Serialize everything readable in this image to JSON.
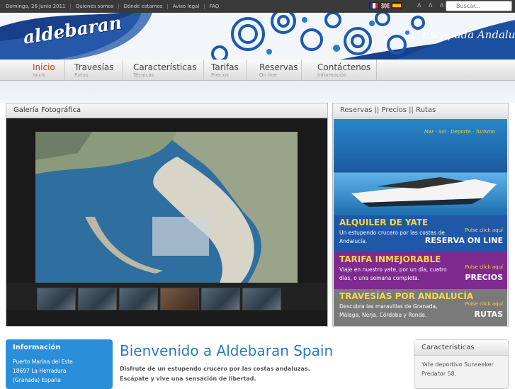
{
  "topbar": {
    "date": "Domingo, 26 Junio 2011",
    "links": [
      "Quienes somos",
      "Dónde estamos",
      "Aviso legal",
      "FAQ"
    ],
    "font_size_controls": "A A A",
    "search_placeholder": "Buscar..."
  },
  "header": {
    "logo": "aldebaran",
    "slogan": "Escapada Andaluza"
  },
  "nav": [
    {
      "label": "Inicio",
      "sub": "Inicio"
    },
    {
      "label": "Travesías",
      "sub": "Rutas"
    },
    {
      "label": "Características",
      "sub": "Técnicas"
    },
    {
      "label": "Tarifas",
      "sub": "Precios"
    },
    {
      "label": "Reservas",
      "sub": "On line"
    },
    {
      "label": "Contáctenos",
      "sub": "Información"
    }
  ],
  "gallery": {
    "title": "Galería Fotográfica"
  },
  "reservas": {
    "title": "Reservas || Precios || Rutas",
    "tagline": "Mar · Sol · Deporte · Turismo",
    "boxes": [
      {
        "title": "ALQUILER DE YATE",
        "desc": "Un estupendo crucero por las costas de Andalucía.",
        "click": "Pulse click aquí",
        "button": "RESERVA ON LINE",
        "color": "#1f58a8"
      },
      {
        "title": "TARIFA INMEJORABLE",
        "desc": "Viaje en nuestro yate, por un día, cuatro días, o una semana completa.",
        "click": "Pulse click aquí",
        "button": "PRECIOS",
        "color": "#7e2a8f"
      },
      {
        "title": "TRAVESÍAS POR ANDALUCÍA",
        "desc": "Descubra las maravillas de Granada, Málaga, Nerja, Córdoba y Ronda.",
        "click": "Pulse click aquí",
        "button": "RUTAS",
        "color": "#7a7a7a"
      }
    ]
  },
  "info": {
    "title": "Información",
    "address": [
      "Puerto Marina del Este",
      "18697 La Herradura",
      "(Granada) España"
    ]
  },
  "welcome": {
    "title": "Bienvenido a Aldebaran Spain",
    "line1": "Disfrute de un estupendo crucero por las costas andaluzas.",
    "line2": "Escápate y vive una sensación de libertad."
  },
  "caracteristicas": {
    "title": "Características",
    "text": "Yate deportivo Sunseeker Predator 58."
  },
  "colors": {
    "accent": "#2a7ac0",
    "nav_active": "#d04010",
    "header_blue": "#1b4fa0"
  }
}
